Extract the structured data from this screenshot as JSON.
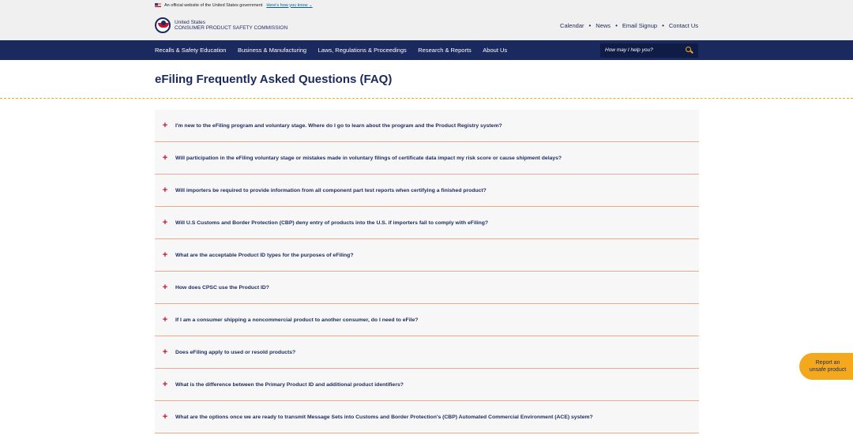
{
  "gov_banner": {
    "text": "An official website of the United States government",
    "link": "Here's how you know"
  },
  "header": {
    "logo_line1": "United States",
    "logo_line2": "CONSUMER PRODUCT SAFETY COMMISSION",
    "links": [
      "Calendar",
      "News",
      "Email Signup",
      "Contact Us"
    ]
  },
  "nav": {
    "items": [
      "Recalls & Safety Education",
      "Business & Manufacturing",
      "Laws, Regulations & Proceedings",
      "Research & Reports",
      "About Us"
    ],
    "search_placeholder": "How may I help you?"
  },
  "page": {
    "title": "eFiling Frequently Asked Questions (FAQ)"
  },
  "faq": [
    "I'm new to the eFiling program and voluntary stage. Where do I go to learn about the program and the Product Registry system?",
    "Will participation in the eFiling voluntary stage or mistakes made in voluntary filings of certificate data impact my risk score or cause shipment delays?",
    "Will importers be required to provide information from all component part test reports when certifying a finished product?",
    "Will U.S Customs and Border Protection (CBP) deny entry of products into the U.S. if importers fail to comply with eFiling?",
    "What are the acceptable Product ID types for the purposes of eFiling?",
    "How does CPSC use the Product ID?",
    "If I am a consumer shipping a noncommercial product to another consumer, do I need to eFile?",
    "Does eFiling apply to used or resold products?",
    "What is the difference between the Primary Product ID and additional product identifiers?",
    "What are the options once we are ready to transmit Message Sets into Customs and Border Protection's (CBP) Automated Commercial Environment (ACE) system?"
  ],
  "report_button": {
    "line1": "Report an",
    "line2": "unsafe product"
  },
  "colors": {
    "navy": "#1b2a5e",
    "accent_red": "#c8102e",
    "accent_orange": "#f4a81d"
  }
}
